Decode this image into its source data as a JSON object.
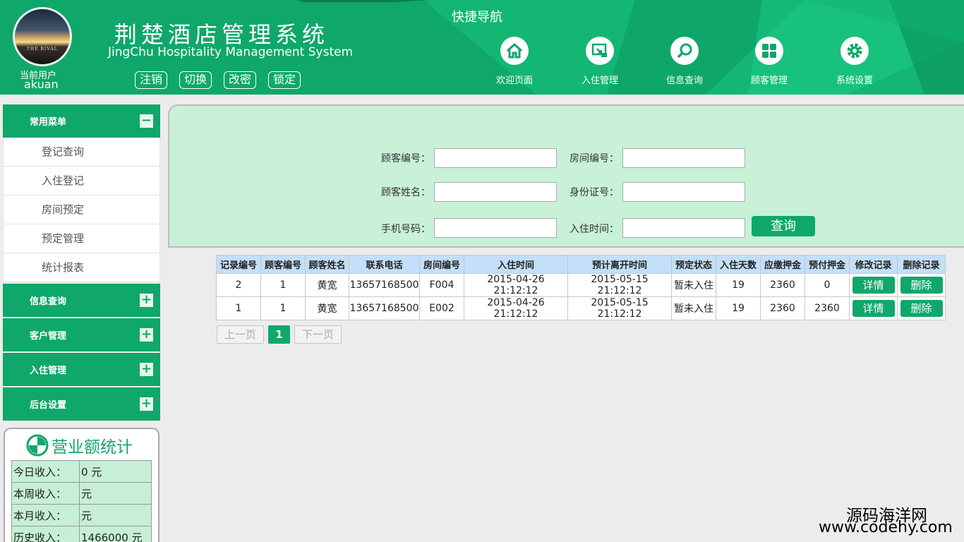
{
  "header": {
    "current_user_label": "当前用户",
    "current_user_name": "akuan",
    "system_title": "荆楚酒店管理系统",
    "system_subtitle": "JingChu Hospitality Management System",
    "actions": [
      "注销",
      "切换",
      "改密",
      "锁定"
    ],
    "quick_nav_title": "快捷导航",
    "nav": [
      {
        "label": "欢迎页面",
        "icon": "home-icon"
      },
      {
        "label": "入住管理",
        "icon": "checkin-icon"
      },
      {
        "label": "信息查询",
        "icon": "search-icon"
      },
      {
        "label": "顾客管理",
        "icon": "grid-icon"
      },
      {
        "label": "系统设置",
        "icon": "gear-icon"
      }
    ],
    "avatar_caption": "THE RIVAL",
    "accent_color": "#0fa86a"
  },
  "sidebar": {
    "sections": [
      {
        "title": "常用菜单",
        "state": "−",
        "items": [
          "登记查询",
          "入住登记",
          "房间预定",
          "预定管理",
          "统计报表"
        ]
      },
      {
        "title": "信息查询",
        "state": "+"
      },
      {
        "title": "客户管理",
        "state": "+"
      },
      {
        "title": "入住管理",
        "state": "+"
      },
      {
        "title": "后台设置",
        "state": "+"
      }
    ],
    "stats": {
      "title": "营业额统计",
      "rows": [
        {
          "k": "今日收入：",
          "v": "0 元"
        },
        {
          "k": "本周收入：",
          "v": "元"
        },
        {
          "k": "本月收入：",
          "v": "元"
        },
        {
          "k": "历史收入：",
          "v": "1466000 元"
        }
      ]
    }
  },
  "search": {
    "customer_id_label": "顾客编号：",
    "room_id_label": "房间编号：",
    "customer_name_label": "顾客姓名：",
    "id_card_label": "身份证号：",
    "phone_label": "手机号码：",
    "checkin_time_label": "入住时间：",
    "query_button": "查询"
  },
  "table": {
    "headers": [
      "记录编号",
      "顾客编号",
      "顾客姓名",
      "联系电话",
      "房间编号",
      "入住时间",
      "预计离开时间",
      "预定状态",
      "入住天数",
      "应缴押金",
      "预付押金",
      "修改记录",
      "删除记录"
    ],
    "detail_button": "详情",
    "delete_button": "删除",
    "rows": [
      [
        "2",
        "1",
        "黄宽",
        "13657168500",
        "F004",
        "2015-04-26 21:12:12",
        "2015-05-15 21:12:12",
        "暂未入住",
        "19",
        "2360",
        "0"
      ],
      [
        "1",
        "1",
        "黄宽",
        "13657168500",
        "E002",
        "2015-04-26 21:12:12",
        "2015-05-15 21:12:12",
        "暂未入住",
        "19",
        "2360",
        "2360"
      ]
    ]
  },
  "pager": {
    "prev": "上一页",
    "current": "1",
    "next": "下一页"
  },
  "watermark": {
    "line1": "源码海洋网",
    "line2": "www.codehy.com"
  }
}
